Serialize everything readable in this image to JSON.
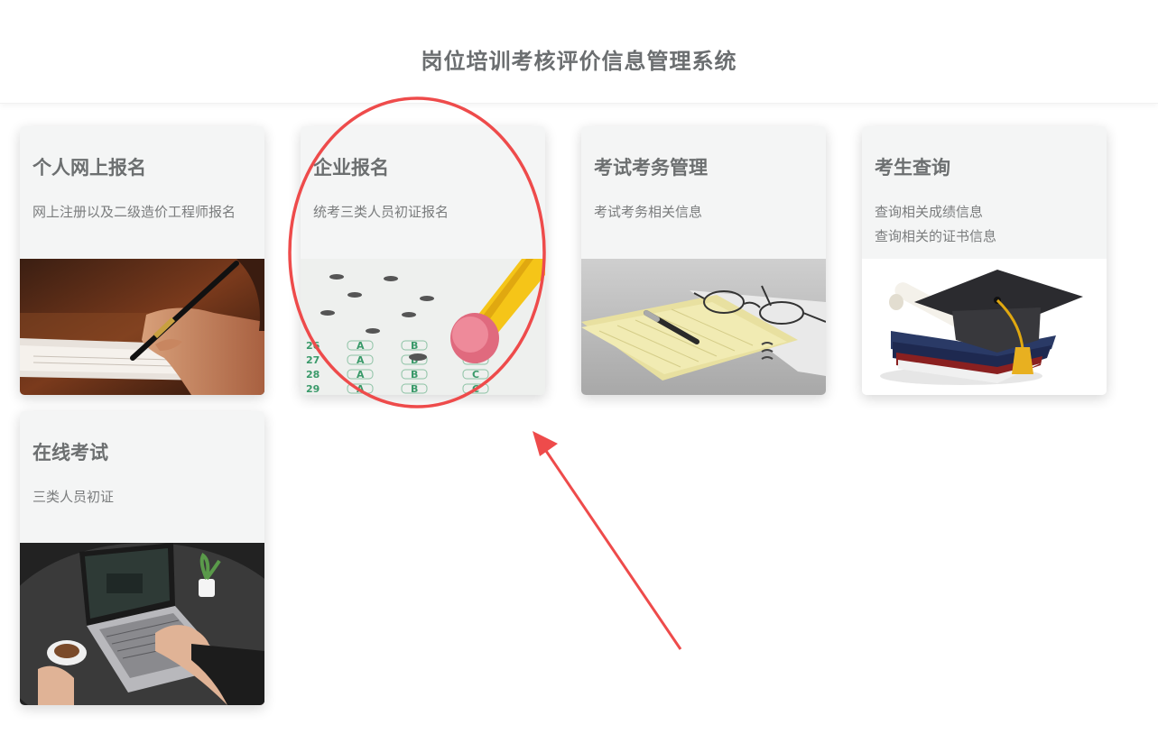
{
  "header": {
    "title": "岗位培训考核评价信息管理系统"
  },
  "cards": [
    {
      "title": "个人网上报名",
      "desc": [
        "网上注册以及二级造价工程师报名"
      ],
      "image": "hand-writing-with-pen-photo"
    },
    {
      "title": "企业报名",
      "desc": [
        "统考三类人员初证报名"
      ],
      "image": "answer-sheet-with-pencil-photo"
    },
    {
      "title": "考试考务管理",
      "desc": [
        "考试考务相关信息"
      ],
      "image": "notebook-glasses-pen-photo"
    },
    {
      "title": "考生查询",
      "desc": [
        "查询相关成绩信息",
        "查询相关的证书信息"
      ],
      "image": "graduation-cap-diploma-photo"
    },
    {
      "title": "在线考试",
      "desc": [
        "三类人员初证"
      ],
      "image": "laptop-typing-coffee-photo"
    }
  ],
  "colors": {
    "annotation_red": "#ee4b4b",
    "title_gray": "#6b6e70",
    "card_bg": "#f4f5f5"
  }
}
